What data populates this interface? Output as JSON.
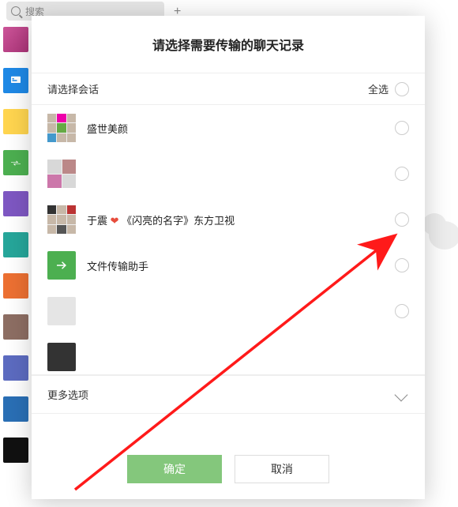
{
  "search": {
    "placeholder": "搜索"
  },
  "modal": {
    "title": "请选择需要传输的聊天记录",
    "chooseSession": "请选择会话",
    "selectAll": "全选",
    "moreOptions": "更多选项",
    "rows": [
      {
        "name": "盛世美颜"
      },
      {
        "name": ""
      },
      {
        "name_pre": "于震",
        "heart": "❤",
        "name_post": "《闪亮的名字》东方卫视"
      },
      {
        "name": "文件传输助手"
      },
      {
        "name": ""
      },
      {
        "name": ""
      }
    ],
    "buttons": {
      "ok": "确定",
      "cancel": "取消"
    }
  }
}
